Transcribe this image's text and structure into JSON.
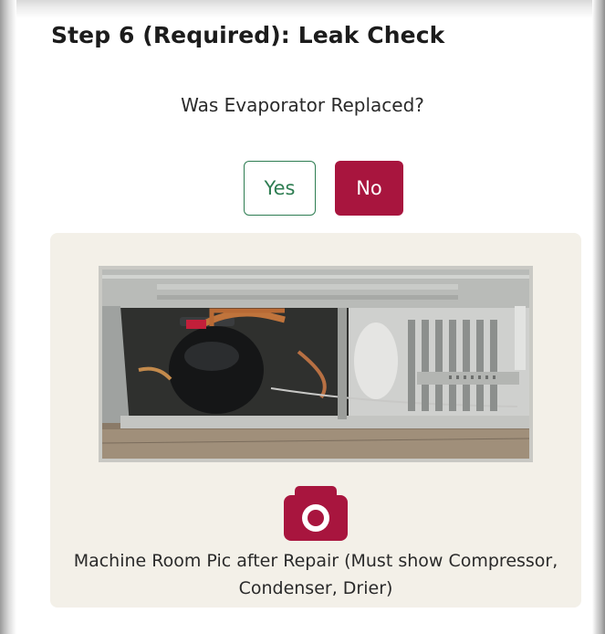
{
  "step": {
    "title": "Step 6 (Required): Leak Check",
    "question": "Was Evaporator Replaced?",
    "options": {
      "yes_label": "Yes",
      "no_label": "No",
      "selected": "No"
    }
  },
  "photo_section": {
    "image_description_name": "machine-room-photo",
    "caption": "Machine Room Pic after Repair (Must show Compressor, Condenser, Drier)",
    "camera_icon": "camera-icon"
  },
  "colors": {
    "accent": "#a8153e",
    "yes_border": "#2e7d52",
    "panel_bg": "#f3f0e8"
  }
}
